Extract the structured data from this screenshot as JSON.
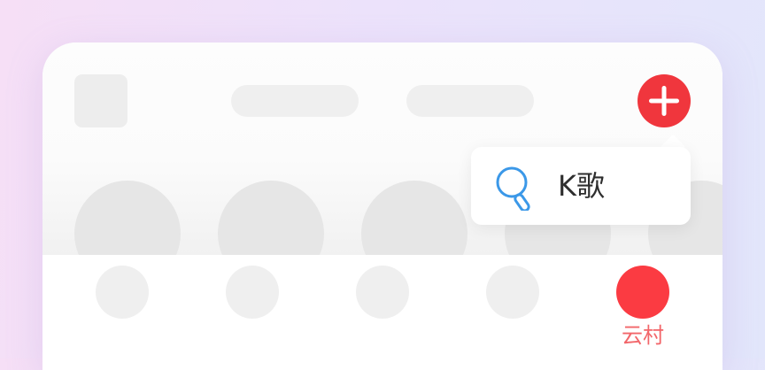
{
  "colors": {
    "accent": "#f0363d",
    "active_tab": "#fb3b42",
    "tab_label": "#f2666a",
    "search_icon": "#3b98e8",
    "skeleton": "#efefef"
  },
  "header": {
    "add_icon": "plus-icon"
  },
  "popup_menu": {
    "items": [
      {
        "icon": "search-icon",
        "label": "K歌"
      }
    ]
  },
  "tab_bar": {
    "active_tab_label": "云村"
  }
}
